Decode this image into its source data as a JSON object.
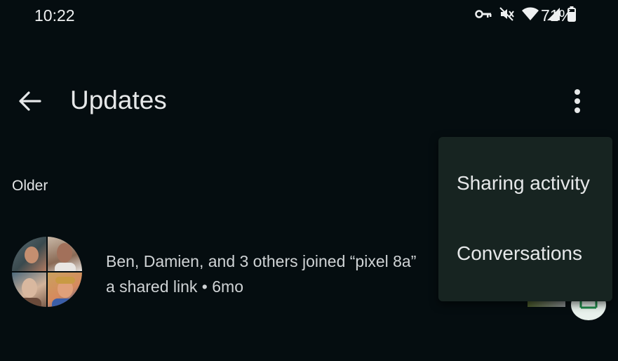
{
  "status_bar": {
    "time": "10:22",
    "battery_percent": "71%",
    "icons": [
      "vpn-key-icon",
      "muted-icon",
      "wifi-icon",
      "cell-signal-icon",
      "battery-icon"
    ]
  },
  "app_bar": {
    "title": "Updates",
    "back_icon": "arrow-back-icon",
    "overflow_icon": "more-vert-icon"
  },
  "section": {
    "label": "Older"
  },
  "updates": [
    {
      "line1": "Ben, Damien, and 3 others joined “pixel 8a”",
      "line2": "a shared link • 6mo"
    }
  ],
  "overflow_menu": {
    "items": [
      {
        "label": "Sharing activity"
      },
      {
        "label": "Conversations"
      }
    ]
  },
  "colors": {
    "background": "#050d10",
    "menu_background": "#172421",
    "text_primary": "#e6e8e9",
    "text_secondary": "#cfd3d5",
    "fab": "#e8f1ec",
    "fab_icon": "#1e8a4a"
  }
}
